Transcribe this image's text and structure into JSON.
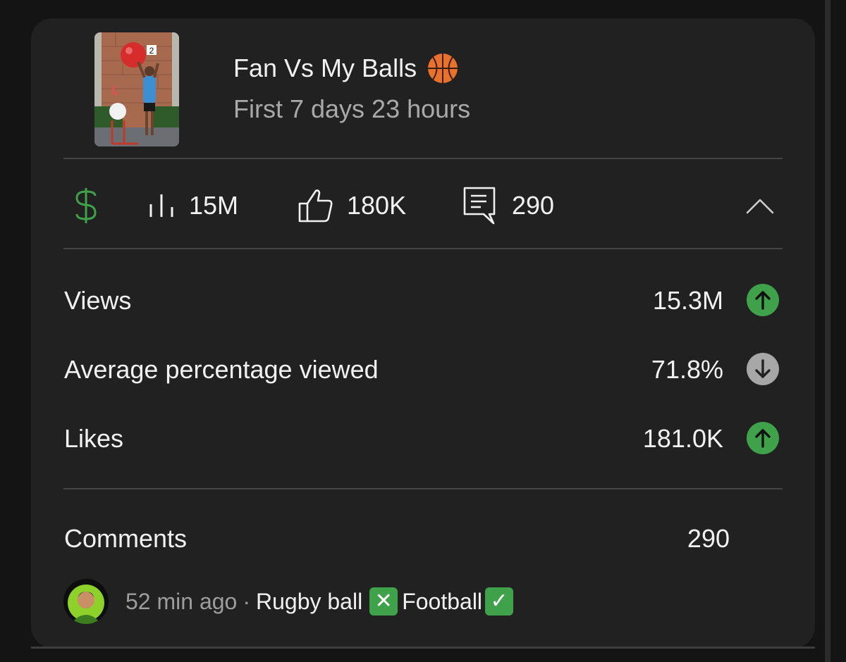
{
  "video": {
    "title": "Fan Vs My Balls",
    "title_emoji": "basketball-emoji",
    "subtitle": "First 7 days 23 hours",
    "thumbnail_badge": "2"
  },
  "stats_bar": {
    "monetization_icon": "dollar-icon",
    "monetization_color": "#3fa14a",
    "views": {
      "icon": "bar-chart-icon",
      "value": "15M"
    },
    "likes": {
      "icon": "thumbs-up-icon",
      "value": "180K"
    },
    "comments": {
      "icon": "comment-icon",
      "value": "290"
    },
    "collapse_icon": "chevron-up-icon"
  },
  "metrics": [
    {
      "label": "Views",
      "value": "15.3M",
      "trend": "up",
      "trend_color": "#3fa14a"
    },
    {
      "label": "Average percentage viewed",
      "value": "71.8%",
      "trend": "down",
      "trend_color": "#a7a7a7"
    },
    {
      "label": "Likes",
      "value": "181.0K",
      "trend": "up",
      "trend_color": "#3fa14a"
    }
  ],
  "comments": {
    "label": "Comments",
    "count": "290",
    "latest": {
      "time": "52 min ago",
      "separator": "·",
      "text_part1": "Rugby ball",
      "emoji1": "✕",
      "text_part2": "Football",
      "emoji2": "✓"
    }
  }
}
